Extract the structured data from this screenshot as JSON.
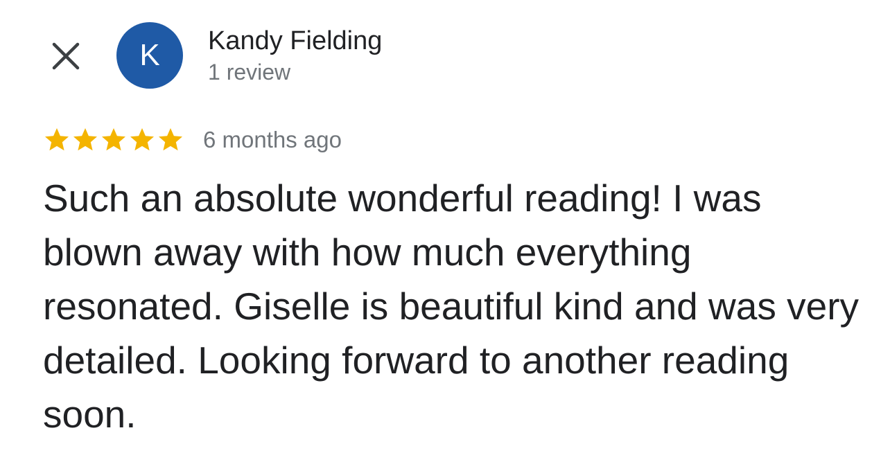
{
  "header": {
    "close_icon": "close-icon",
    "avatar": {
      "initial": "K",
      "color": "#1f5aa6"
    },
    "reviewer_name": "Kandy Fielding",
    "review_count": "1 review"
  },
  "review": {
    "rating": 5,
    "rating_max": 5,
    "star_icon": "star-icon",
    "star_color": "#f4b400",
    "date": "6 months ago",
    "text": "Such an absolute wonderful reading! I was blown away with how much everything resonated. Giselle is beautiful kind and was very detailed. Looking forward to another reading soon."
  }
}
